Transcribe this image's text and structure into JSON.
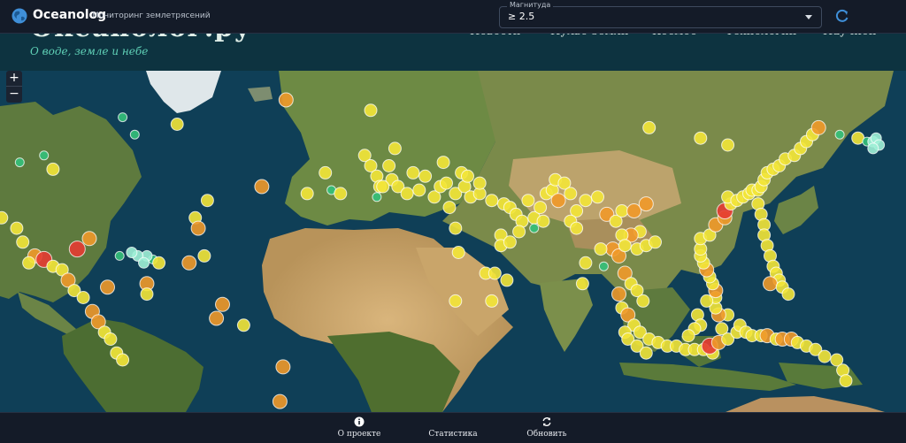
{
  "app": {
    "name": "Oceanolog",
    "subtitle": "Мониторинг землетрясений",
    "logo_icon": "globe-icon"
  },
  "filter": {
    "legend": "Магнитуда",
    "value": "≥ 2.5",
    "caret_icon": "chevron-down-icon"
  },
  "refresh": {
    "icon": "refresh-icon"
  },
  "site": {
    "title": "Океанолог.ру",
    "tagline": "О воде, земле и небе",
    "nav": [
      "Новости",
      "Пульс Земли",
      "Космос",
      "Технологии",
      "Научпоп"
    ]
  },
  "zoom": {
    "in": "+",
    "out": "−"
  },
  "bottom_nav": [
    {
      "label": "О проекте",
      "icon": "info-icon"
    },
    {
      "label": "Статистика",
      "icon": "stats-icon"
    },
    {
      "label": "Обновить",
      "icon": "sync-icon"
    }
  ],
  "colors": {
    "ocean": "#0f3f57",
    "land": "#5f7a3c",
    "desert": "#c9a46b",
    "ice": "#eaf0f2",
    "quake_green": "#34c07a",
    "quake_yellow": "#f3e538",
    "quake_orange": "#f0992a",
    "quake_red": "#e63b32",
    "quake_cyan": "#9ef0d6"
  },
  "earthquakes": [
    {
      "lon": -132,
      "lat": 70,
      "level": "yellow"
    },
    {
      "lon": -127.4,
      "lat": 36.3,
      "level": "yellow"
    },
    {
      "lon": -125,
      "lat": 41,
      "level": "yellow"
    },
    {
      "lon": -116,
      "lat": 33,
      "level": "red"
    },
    {
      "lon": -114,
      "lat": 32,
      "level": "yellow"
    },
    {
      "lon": -110,
      "lat": 29,
      "level": "yellow"
    },
    {
      "lon": -105,
      "lat": 26,
      "level": "yellow"
    },
    {
      "lon": -103,
      "lat": 22,
      "level": "yellow"
    },
    {
      "lon": -99,
      "lat": 18,
      "level": "orange"
    },
    {
      "lon": -96,
      "lat": 17,
      "level": "red"
    },
    {
      "lon": -101,
      "lat": 16,
      "level": "yellow"
    },
    {
      "lon": -93,
      "lat": 15,
      "level": "yellow"
    },
    {
      "lon": -90,
      "lat": 14,
      "level": "yellow"
    },
    {
      "lon": -88,
      "lat": 11,
      "level": "orange"
    },
    {
      "lon": -86,
      "lat": 8,
      "level": "yellow"
    },
    {
      "lon": -83,
      "lat": 6,
      "level": "yellow"
    },
    {
      "lon": -80,
      "lat": 2,
      "level": "orange"
    },
    {
      "lon": -78,
      "lat": -1,
      "level": "orange"
    },
    {
      "lon": -76,
      "lat": -4,
      "level": "yellow"
    },
    {
      "lon": -74,
      "lat": -6,
      "level": "yellow"
    },
    {
      "lon": -72,
      "lat": -10,
      "level": "yellow"
    },
    {
      "lon": -70,
      "lat": -12,
      "level": "yellow"
    },
    {
      "lon": -104,
      "lat": 45,
      "level": "green"
    },
    {
      "lon": -96,
      "lat": 47,
      "level": "green"
    },
    {
      "lon": -93,
      "lat": 43,
      "level": "yellow"
    },
    {
      "lon": -81,
      "lat": 23,
      "level": "orange"
    },
    {
      "lon": -85,
      "lat": 20,
      "level": "red"
    },
    {
      "lon": -75,
      "lat": 9,
      "level": "orange"
    },
    {
      "lon": -60,
      "lat": 17,
      "level": "green"
    },
    {
      "lon": -62,
      "lat": 18,
      "level": "cyan"
    },
    {
      "lon": -65,
      "lat": 18,
      "level": "cyan"
    },
    {
      "lon": -67,
      "lat": 19,
      "level": "cyan"
    },
    {
      "lon": -63,
      "lat": 16,
      "level": "cyan"
    },
    {
      "lon": -71,
      "lat": 18,
      "level": "green"
    },
    {
      "lon": -58,
      "lat": 16,
      "level": "yellow"
    },
    {
      "lon": -62,
      "lat": 10,
      "level": "orange"
    },
    {
      "lon": -62,
      "lat": 7,
      "level": "yellow"
    },
    {
      "lon": -52,
      "lat": 56,
      "level": "yellow"
    },
    {
      "lon": -70,
      "lat": 58,
      "level": "green"
    },
    {
      "lon": -66,
      "lat": 53,
      "level": "green"
    },
    {
      "lon": -46,
      "lat": 29,
      "level": "yellow"
    },
    {
      "lon": -42,
      "lat": 34,
      "level": "yellow"
    },
    {
      "lon": -45,
      "lat": 26,
      "level": "orange"
    },
    {
      "lon": -48,
      "lat": 16,
      "level": "orange"
    },
    {
      "lon": -43,
      "lat": 18,
      "level": "yellow"
    },
    {
      "lon": -39,
      "lat": 0,
      "level": "orange"
    },
    {
      "lon": -37,
      "lat": 4,
      "level": "orange"
    },
    {
      "lon": -24,
      "lat": 38,
      "level": "orange"
    },
    {
      "lon": -16,
      "lat": 63,
      "level": "orange"
    },
    {
      "lon": -30,
      "lat": -2,
      "level": "yellow"
    },
    {
      "lon": -17,
      "lat": -14,
      "level": "orange"
    },
    {
      "lon": -18,
      "lat": -24,
      "level": "orange"
    },
    {
      "lon": -14,
      "lat": -32,
      "level": "yellow"
    },
    {
      "lon": -9,
      "lat": 36,
      "level": "yellow"
    },
    {
      "lon": -3,
      "lat": 42,
      "level": "yellow"
    },
    {
      "lon": -1,
      "lat": 37,
      "level": "green"
    },
    {
      "lon": 2,
      "lat": 36,
      "level": "yellow"
    },
    {
      "lon": 10,
      "lat": 47,
      "level": "yellow"
    },
    {
      "lon": 12,
      "lat": 44,
      "level": "yellow"
    },
    {
      "lon": 14,
      "lat": 41,
      "level": "yellow"
    },
    {
      "lon": 15,
      "lat": 38,
      "level": "yellow"
    },
    {
      "lon": 19,
      "lat": 40,
      "level": "yellow"
    },
    {
      "lon": 21,
      "lat": 38,
      "level": "yellow"
    },
    {
      "lon": 24,
      "lat": 36,
      "level": "yellow"
    },
    {
      "lon": 28,
      "lat": 37,
      "level": "yellow"
    },
    {
      "lon": 33,
      "lat": 35,
      "level": "yellow"
    },
    {
      "lon": 35,
      "lat": 38,
      "level": "yellow"
    },
    {
      "lon": 37,
      "lat": 39,
      "level": "yellow"
    },
    {
      "lon": 40,
      "lat": 36,
      "level": "yellow"
    },
    {
      "lon": 43,
      "lat": 38,
      "level": "yellow"
    },
    {
      "lon": 45,
      "lat": 35,
      "level": "yellow"
    },
    {
      "lon": 48,
      "lat": 36,
      "level": "yellow"
    },
    {
      "lon": 52,
      "lat": 34,
      "level": "yellow"
    },
    {
      "lon": 56,
      "lat": 33,
      "level": "yellow"
    },
    {
      "lon": 58,
      "lat": 32,
      "level": "yellow"
    },
    {
      "lon": 26,
      "lat": 42,
      "level": "yellow"
    },
    {
      "lon": 30,
      "lat": 41,
      "level": "yellow"
    },
    {
      "lon": 20,
      "lat": 49,
      "level": "yellow"
    },
    {
      "lon": 18,
      "lat": 44,
      "level": "yellow"
    },
    {
      "lon": 36,
      "lat": 45,
      "level": "yellow"
    },
    {
      "lon": 42,
      "lat": 42,
      "level": "yellow"
    },
    {
      "lon": 44,
      "lat": 41,
      "level": "yellow"
    },
    {
      "lon": 48,
      "lat": 39,
      "level": "yellow"
    },
    {
      "lon": 60,
      "lat": 30,
      "level": "yellow"
    },
    {
      "lon": 62,
      "lat": 28,
      "level": "yellow"
    },
    {
      "lon": 66,
      "lat": 29,
      "level": "yellow"
    },
    {
      "lon": 68,
      "lat": 32,
      "level": "yellow"
    },
    {
      "lon": 64,
      "lat": 34,
      "level": "yellow"
    },
    {
      "lon": 70,
      "lat": 36,
      "level": "yellow"
    },
    {
      "lon": 72,
      "lat": 37,
      "level": "yellow"
    },
    {
      "lon": 73,
      "lat": 40,
      "level": "yellow"
    },
    {
      "lon": 76,
      "lat": 39,
      "level": "yellow"
    },
    {
      "lon": 74,
      "lat": 34,
      "level": "orange"
    },
    {
      "lon": 78,
      "lat": 36,
      "level": "yellow"
    },
    {
      "lon": 80,
      "lat": 31,
      "level": "yellow"
    },
    {
      "lon": 78,
      "lat": 28,
      "level": "yellow"
    },
    {
      "lon": 83,
      "lat": 34,
      "level": "yellow"
    },
    {
      "lon": 87,
      "lat": 35,
      "level": "yellow"
    },
    {
      "lon": 90,
      "lat": 30,
      "level": "orange"
    },
    {
      "lon": 93,
      "lat": 28,
      "level": "yellow"
    },
    {
      "lon": 95,
      "lat": 31,
      "level": "yellow"
    },
    {
      "lon": 99,
      "lat": 31,
      "level": "orange"
    },
    {
      "lon": 103,
      "lat": 33,
      "level": "orange"
    },
    {
      "lon": 101,
      "lat": 25,
      "level": "yellow"
    },
    {
      "lon": 98,
      "lat": 24,
      "level": "orange"
    },
    {
      "lon": 95,
      "lat": 24,
      "level": "yellow"
    },
    {
      "lon": 92,
      "lat": 20,
      "level": "orange"
    },
    {
      "lon": 94,
      "lat": 18,
      "level": "orange"
    },
    {
      "lon": 96,
      "lat": 21,
      "level": "yellow"
    },
    {
      "lon": 100,
      "lat": 20,
      "level": "yellow"
    },
    {
      "lon": 103,
      "lat": 21,
      "level": "yellow"
    },
    {
      "lon": 106,
      "lat": 22,
      "level": "yellow"
    },
    {
      "lon": 96,
      "lat": 13,
      "level": "orange"
    },
    {
      "lon": 98,
      "lat": 10,
      "level": "yellow"
    },
    {
      "lon": 100,
      "lat": 8,
      "level": "yellow"
    },
    {
      "lon": 102,
      "lat": 5,
      "level": "yellow"
    },
    {
      "lon": 94,
      "lat": 7,
      "level": "orange"
    },
    {
      "lon": 95,
      "lat": 3,
      "level": "yellow"
    },
    {
      "lon": 97,
      "lat": 1,
      "level": "orange"
    },
    {
      "lon": 99,
      "lat": -2,
      "level": "yellow"
    },
    {
      "lon": 101,
      "lat": -4,
      "level": "yellow"
    },
    {
      "lon": 104,
      "lat": -6,
      "level": "yellow"
    },
    {
      "lon": 107,
      "lat": -7,
      "level": "yellow"
    },
    {
      "lon": 110,
      "lat": -8,
      "level": "yellow"
    },
    {
      "lon": 113,
      "lat": -8,
      "level": "yellow"
    },
    {
      "lon": 116,
      "lat": -9,
      "level": "yellow"
    },
    {
      "lon": 119,
      "lat": -9,
      "level": "yellow"
    },
    {
      "lon": 122,
      "lat": -9,
      "level": "yellow"
    },
    {
      "lon": 125,
      "lat": -10,
      "level": "yellow"
    },
    {
      "lon": 124,
      "lat": -8,
      "level": "red"
    },
    {
      "lon": 127,
      "lat": -7,
      "level": "orange"
    },
    {
      "lon": 128,
      "lat": -3,
      "level": "yellow"
    },
    {
      "lon": 130,
      "lat": -6,
      "level": "yellow"
    },
    {
      "lon": 133,
      "lat": -4,
      "level": "yellow"
    },
    {
      "lon": 134,
      "lat": -2,
      "level": "yellow"
    },
    {
      "lon": 136,
      "lat": -4,
      "level": "yellow"
    },
    {
      "lon": 138,
      "lat": -5,
      "level": "yellow"
    },
    {
      "lon": 141,
      "lat": -5,
      "level": "yellow"
    },
    {
      "lon": 143,
      "lat": -5,
      "level": "orange"
    },
    {
      "lon": 146,
      "lat": -6,
      "level": "yellow"
    },
    {
      "lon": 148,
      "lat": -6,
      "level": "orange"
    },
    {
      "lon": 151,
      "lat": -6,
      "level": "orange"
    },
    {
      "lon": 153,
      "lat": -7,
      "level": "yellow"
    },
    {
      "lon": 156,
      "lat": -8,
      "level": "yellow"
    },
    {
      "lon": 159,
      "lat": -9,
      "level": "yellow"
    },
    {
      "lon": 162,
      "lat": -11,
      "level": "yellow"
    },
    {
      "lon": 166,
      "lat": -12,
      "level": "yellow"
    },
    {
      "lon": 168,
      "lat": -15,
      "level": "yellow"
    },
    {
      "lon": 169,
      "lat": -18,
      "level": "yellow"
    },
    {
      "lon": 130,
      "lat": 1,
      "level": "yellow"
    },
    {
      "lon": 127,
      "lat": 1,
      "level": "orange"
    },
    {
      "lon": 126,
      "lat": 3,
      "level": "yellow"
    },
    {
      "lon": 126,
      "lat": 6,
      "level": "yellow"
    },
    {
      "lon": 126,
      "lat": 8,
      "level": "orange"
    },
    {
      "lon": 125,
      "lat": 10,
      "level": "yellow"
    },
    {
      "lon": 124,
      "lat": 12,
      "level": "yellow"
    },
    {
      "lon": 123,
      "lat": 14,
      "level": "orange"
    },
    {
      "lon": 122,
      "lat": 16,
      "level": "yellow"
    },
    {
      "lon": 121,
      "lat": 18,
      "level": "yellow"
    },
    {
      "lon": 121,
      "lat": 20,
      "level": "yellow"
    },
    {
      "lon": 121,
      "lat": 23,
      "level": "yellow"
    },
    {
      "lon": 124,
      "lat": 24,
      "level": "yellow"
    },
    {
      "lon": 123,
      "lat": 5,
      "level": "yellow"
    },
    {
      "lon": 120,
      "lat": 1,
      "level": "yellow"
    },
    {
      "lon": 121,
      "lat": -2,
      "level": "yellow"
    },
    {
      "lon": 119,
      "lat": -3,
      "level": "yellow"
    },
    {
      "lon": 117,
      "lat": -5,
      "level": "yellow"
    },
    {
      "lon": 126,
      "lat": 27,
      "level": "orange"
    },
    {
      "lon": 129,
      "lat": 29,
      "level": "orange"
    },
    {
      "lon": 129,
      "lat": 31,
      "level": "red"
    },
    {
      "lon": 131,
      "lat": 33,
      "level": "yellow"
    },
    {
      "lon": 130,
      "lat": 35,
      "level": "yellow"
    },
    {
      "lon": 133,
      "lat": 34,
      "level": "yellow"
    },
    {
      "lon": 135,
      "lat": 35,
      "level": "yellow"
    },
    {
      "lon": 137,
      "lat": 36,
      "level": "yellow"
    },
    {
      "lon": 138,
      "lat": 37,
      "level": "yellow"
    },
    {
      "lon": 140,
      "lat": 37,
      "level": "yellow"
    },
    {
      "lon": 141,
      "lat": 38,
      "level": "yellow"
    },
    {
      "lon": 142,
      "lat": 40,
      "level": "yellow"
    },
    {
      "lon": 143,
      "lat": 42,
      "level": "yellow"
    },
    {
      "lon": 145,
      "lat": 43,
      "level": "yellow"
    },
    {
      "lon": 147,
      "lat": 44,
      "level": "yellow"
    },
    {
      "lon": 149,
      "lat": 46,
      "level": "yellow"
    },
    {
      "lon": 152,
      "lat": 47,
      "level": "yellow"
    },
    {
      "lon": 154,
      "lat": 49,
      "level": "yellow"
    },
    {
      "lon": 156,
      "lat": 51,
      "level": "yellow"
    },
    {
      "lon": 158,
      "lat": 53,
      "level": "yellow"
    },
    {
      "lon": 160,
      "lat": 55,
      "level": "orange"
    },
    {
      "lon": 140,
      "lat": 33,
      "level": "yellow"
    },
    {
      "lon": 141,
      "lat": 30,
      "level": "yellow"
    },
    {
      "lon": 142,
      "lat": 27,
      "level": "yellow"
    },
    {
      "lon": 142,
      "lat": 24,
      "level": "yellow"
    },
    {
      "lon": 143,
      "lat": 21,
      "level": "yellow"
    },
    {
      "lon": 144,
      "lat": 18,
      "level": "yellow"
    },
    {
      "lon": 145,
      "lat": 15,
      "level": "yellow"
    },
    {
      "lon": 146,
      "lat": 13,
      "level": "yellow"
    },
    {
      "lon": 147,
      "lat": 11,
      "level": "yellow"
    },
    {
      "lon": 144,
      "lat": 10,
      "level": "orange"
    },
    {
      "lon": 148,
      "lat": 9,
      "level": "yellow"
    },
    {
      "lon": 150,
      "lat": 7,
      "level": "yellow"
    },
    {
      "lon": 173,
      "lat": 52,
      "level": "yellow"
    },
    {
      "lon": 176,
      "lat": 51,
      "level": "green"
    },
    {
      "lon": 178,
      "lat": 51,
      "level": "cyan"
    },
    {
      "lon": 179,
      "lat": 52,
      "level": "cyan"
    },
    {
      "lon": 180,
      "lat": 50,
      "level": "cyan"
    },
    {
      "lon": 178,
      "lat": 49,
      "level": "cyan"
    },
    {
      "lon": 167,
      "lat": 53,
      "level": "green"
    },
    {
      "lon": 104,
      "lat": 55,
      "level": "yellow"
    },
    {
      "lon": 121,
      "lat": 52,
      "level": "yellow"
    },
    {
      "lon": 130,
      "lat": 50,
      "level": "yellow"
    },
    {
      "lon": 12,
      "lat": 60,
      "level": "yellow"
    },
    {
      "lon": 14,
      "lat": 35,
      "level": "green"
    },
    {
      "lon": 16,
      "lat": 38,
      "level": "yellow"
    },
    {
      "lon": 38,
      "lat": 32,
      "level": "yellow"
    },
    {
      "lon": 40,
      "lat": 26,
      "level": "yellow"
    },
    {
      "lon": 41,
      "lat": 19,
      "level": "yellow"
    },
    {
      "lon": 50,
      "lat": 13,
      "level": "yellow"
    },
    {
      "lon": 53,
      "lat": 13,
      "level": "yellow"
    },
    {
      "lon": 57,
      "lat": 11,
      "level": "yellow"
    },
    {
      "lon": 52,
      "lat": 5,
      "level": "yellow"
    },
    {
      "lon": 40,
      "lat": 5,
      "level": "yellow"
    },
    {
      "lon": 55,
      "lat": 24,
      "level": "yellow"
    },
    {
      "lon": 55,
      "lat": 21,
      "level": "yellow"
    },
    {
      "lon": 58,
      "lat": 22,
      "level": "yellow"
    },
    {
      "lon": 61,
      "lat": 25,
      "level": "yellow"
    },
    {
      "lon": 66,
      "lat": 26,
      "level": "green"
    },
    {
      "lon": 69,
      "lat": 28,
      "level": "yellow"
    },
    {
      "lon": 80,
      "lat": 26,
      "level": "yellow"
    },
    {
      "lon": 88,
      "lat": 20,
      "level": "yellow"
    },
    {
      "lon": 89,
      "lat": 15,
      "level": "green"
    },
    {
      "lon": 83,
      "lat": 16,
      "level": "yellow"
    },
    {
      "lon": 82,
      "lat": 10,
      "level": "yellow"
    },
    {
      "lon": 96,
      "lat": -4,
      "level": "yellow"
    },
    {
      "lon": 97,
      "lat": -6,
      "level": "yellow"
    },
    {
      "lon": 100,
      "lat": -8,
      "level": "yellow"
    },
    {
      "lon": 103,
      "lat": -10,
      "level": "yellow"
    }
  ]
}
